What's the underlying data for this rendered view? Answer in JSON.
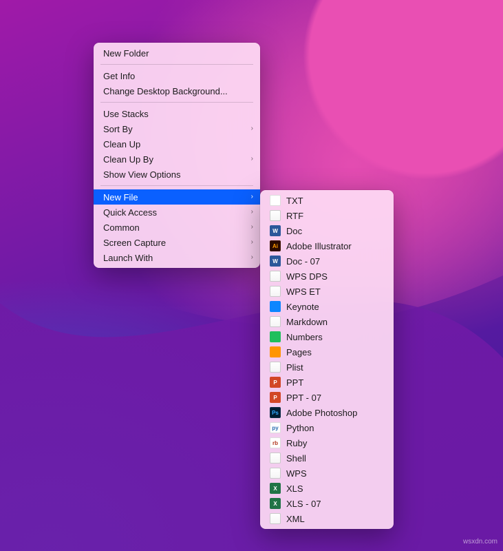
{
  "contextMenu": {
    "groups": [
      [
        {
          "label": "New Folder",
          "submenu": false
        }
      ],
      [
        {
          "label": "Get Info",
          "submenu": false
        },
        {
          "label": "Change Desktop Background...",
          "submenu": false
        }
      ],
      [
        {
          "label": "Use Stacks",
          "submenu": false
        },
        {
          "label": "Sort By",
          "submenu": true
        },
        {
          "label": "Clean Up",
          "submenu": false
        },
        {
          "label": "Clean Up By",
          "submenu": true
        },
        {
          "label": "Show View Options",
          "submenu": false
        }
      ],
      [
        {
          "label": "New File",
          "submenu": true,
          "selected": true
        },
        {
          "label": "Quick Access",
          "submenu": true
        },
        {
          "label": "Common",
          "submenu": true
        },
        {
          "label": "Screen Capture",
          "submenu": true
        },
        {
          "label": "Launch With",
          "submenu": true
        }
      ]
    ]
  },
  "newFileSubmenu": [
    {
      "label": "TXT",
      "icon": "txt",
      "mark": ""
    },
    {
      "label": "RTF",
      "icon": "doc",
      "mark": ""
    },
    {
      "label": "Doc",
      "icon": "word",
      "mark": "W"
    },
    {
      "label": "Adobe Illustrator",
      "icon": "ai",
      "mark": "Ai"
    },
    {
      "label": "Doc - 07",
      "icon": "word",
      "mark": "W"
    },
    {
      "label": "WPS DPS",
      "icon": "doc",
      "mark": ""
    },
    {
      "label": "WPS ET",
      "icon": "doc",
      "mark": ""
    },
    {
      "label": "Keynote",
      "icon": "key",
      "mark": ""
    },
    {
      "label": "Markdown",
      "icon": "doc",
      "mark": ""
    },
    {
      "label": "Numbers",
      "icon": "num",
      "mark": ""
    },
    {
      "label": "Pages",
      "icon": "pages",
      "mark": ""
    },
    {
      "label": "Plist",
      "icon": "doc",
      "mark": ""
    },
    {
      "label": "PPT",
      "icon": "ppt",
      "mark": "P"
    },
    {
      "label": "PPT - 07",
      "icon": "ppt",
      "mark": "P"
    },
    {
      "label": "Adobe Photoshop",
      "icon": "ps",
      "mark": "Ps"
    },
    {
      "label": "Python",
      "icon": "py",
      "mark": "py"
    },
    {
      "label": "Ruby",
      "icon": "ruby",
      "mark": "rb"
    },
    {
      "label": "Shell",
      "icon": "doc",
      "mark": ""
    },
    {
      "label": "WPS",
      "icon": "doc",
      "mark": ""
    },
    {
      "label": "XLS",
      "icon": "xls",
      "mark": "X"
    },
    {
      "label": "XLS - 07",
      "icon": "xls",
      "mark": "X"
    },
    {
      "label": "XML",
      "icon": "doc",
      "mark": ""
    }
  ],
  "glyphs": {
    "chevron": "›"
  },
  "watermark": "wsxdn.com"
}
